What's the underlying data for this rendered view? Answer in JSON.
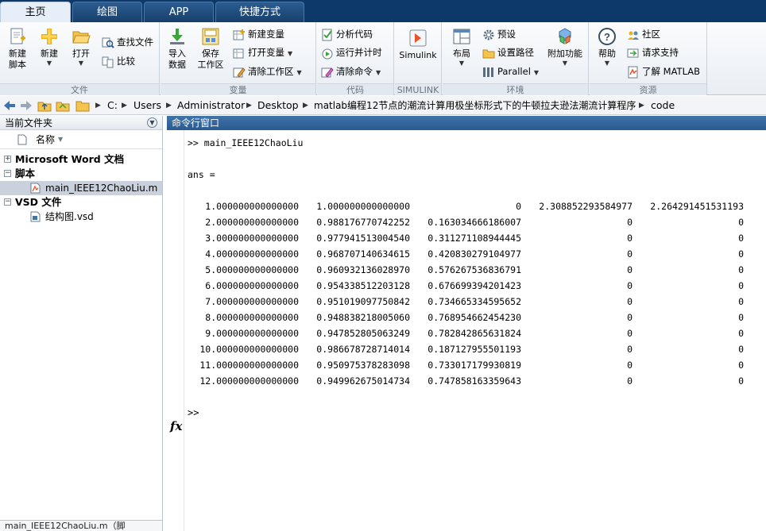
{
  "tabs": [
    {
      "label": "主页",
      "active": true
    },
    {
      "label": "绘图",
      "active": false
    },
    {
      "label": "APP",
      "active": false
    },
    {
      "label": "快捷方式",
      "active": false
    }
  ],
  "ribbon": {
    "file": {
      "group_label": "文件",
      "new_script": [
        "新建",
        "脚本"
      ],
      "new": "新建",
      "open": "打开",
      "find_files": "查找文件",
      "compare": "比较"
    },
    "variable": {
      "group_label": "变量",
      "import": [
        "导入",
        "数据"
      ],
      "save": [
        "保存",
        "工作区"
      ],
      "new_variable": "新建变量",
      "open_variable": "打开变量",
      "clear_workspace": "清除工作区"
    },
    "code": {
      "group_label": "代码",
      "analyze": "分析代码",
      "run_time": "运行并计时",
      "clear_commands": "清除命令"
    },
    "simulink": {
      "group_label": "SIMULINK",
      "simulink": "Simulink"
    },
    "environment": {
      "group_label": "环境",
      "layout": "布局",
      "preferences": "预设",
      "set_path": "设置路径",
      "parallel": "Parallel",
      "addons": "附加功能"
    },
    "resources": {
      "group_label": "资源",
      "help": "帮助",
      "community": "社区",
      "request_support": "请求支持",
      "learn_matlab": "了解 MATLAB"
    }
  },
  "address": {
    "crumbs": [
      "C:",
      "Users",
      "Administrator",
      "Desktop",
      "matlab编程12节点的潮流计算用极坐标形式下的牛顿拉夫逊法潮流计算程序",
      "code"
    ]
  },
  "left_panel": {
    "title": "当前文件夹",
    "column_name": "名称",
    "groups": [
      {
        "label": "Microsoft Word 文档",
        "expanded": false,
        "items": []
      },
      {
        "label": "脚本",
        "expanded": true,
        "items": [
          {
            "label": "main_IEEE12ChaoLiu.m",
            "selected": true
          }
        ]
      },
      {
        "label": "VSD 文件",
        "expanded": true,
        "items": [
          {
            "label": "结构图.vsd",
            "selected": false
          }
        ]
      }
    ],
    "status": "main_IEEE12ChaoLiu.m（脚"
  },
  "command_window": {
    "title": "命令行窗口",
    "command": ">> main_IEEE12ChaoLiu",
    "ans_label": "ans =",
    "rows": [
      [
        "1.000000000000000",
        "1.000000000000000",
        "0",
        "2.308852293584977",
        "2.264291451531193"
      ],
      [
        "2.000000000000000",
        "0.988176770742252",
        "0.163034666186007",
        "0",
        "0"
      ],
      [
        "3.000000000000000",
        "0.977941513004540",
        "0.311271108944445",
        "0",
        "0"
      ],
      [
        "4.000000000000000",
        "0.968707140634615",
        "0.420830279104977",
        "0",
        "0"
      ],
      [
        "5.000000000000000",
        "0.960932136028970",
        "0.576267536836791",
        "0",
        "0"
      ],
      [
        "6.000000000000000",
        "0.954338512203128",
        "0.676699394201423",
        "0",
        "0"
      ],
      [
        "7.000000000000000",
        "0.951019097750842",
        "0.734665334595652",
        "0",
        "0"
      ],
      [
        "8.000000000000000",
        "0.948838218005060",
        "0.768954662454230",
        "0",
        "0"
      ],
      [
        "9.000000000000000",
        "0.947852805063249",
        "0.782842865631824",
        "0",
        "0"
      ],
      [
        "10.000000000000000",
        "0.986678728714014",
        "0.187127955501193",
        "0",
        "0"
      ],
      [
        "11.000000000000000",
        "0.950975378283098",
        "0.733017179930819",
        "0",
        "0"
      ],
      [
        "12.000000000000000",
        "0.949962675014734",
        "0.747858163359643",
        "0",
        "0"
      ]
    ],
    "prompt": ">>",
    "fx_label": "fx"
  },
  "colors": {
    "tabbar": "#0c3967",
    "cmd_header": "#2a5a8f",
    "selected_row": "#c9d1dc"
  }
}
